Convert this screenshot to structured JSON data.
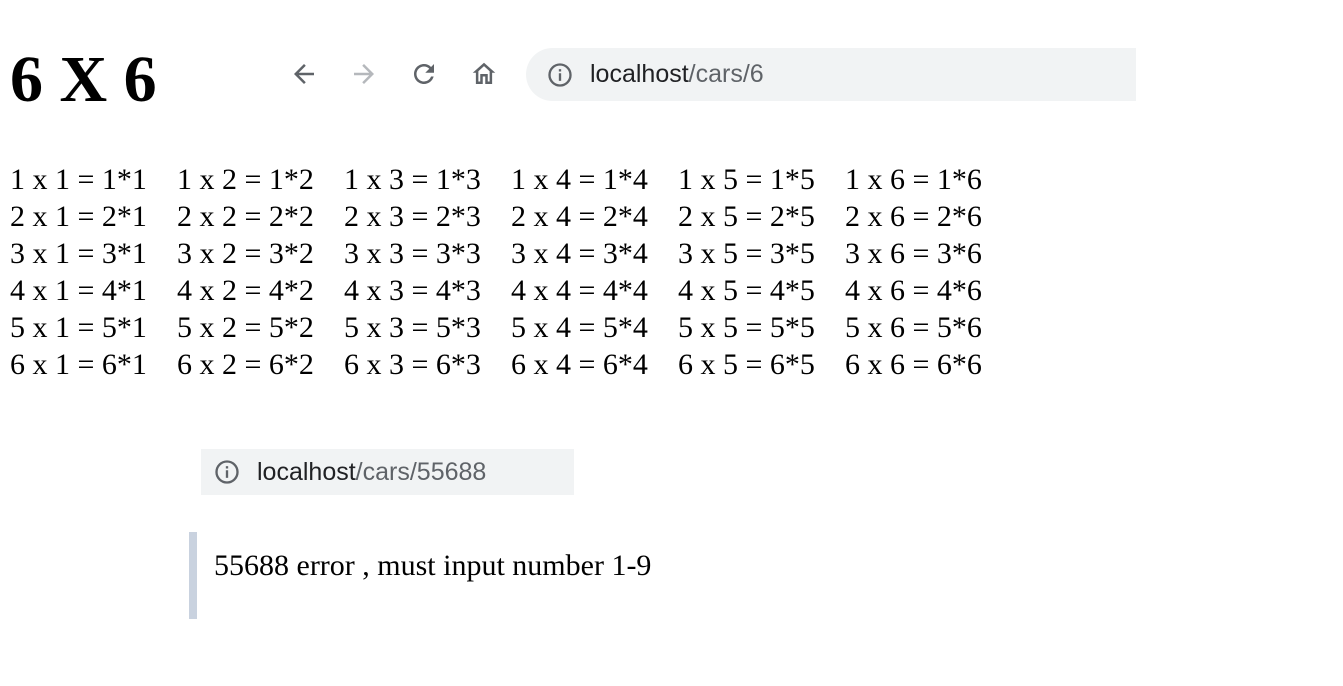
{
  "heading": "6 X 6",
  "browser_top": {
    "nav": {
      "back_icon": "arrow-left-icon",
      "forward_icon": "arrow-right-icon",
      "reload_icon": "reload-icon",
      "home_icon": "home-icon"
    },
    "address": {
      "icon": "info-icon",
      "host": "localhost",
      "path": "/cars/6"
    }
  },
  "table": {
    "rows": [
      [
        "1 x 1 = 1*1",
        "1 x 2 = 1*2",
        "1 x 3 = 1*3",
        "1 x 4 = 1*4",
        "1 x 5 = 1*5",
        "1 x 6 = 1*6"
      ],
      [
        "2 x 1 = 2*1",
        "2 x 2 = 2*2",
        "2 x 3 = 2*3",
        "2 x 4 = 2*4",
        "2 x 5 = 2*5",
        "2 x 6 = 2*6"
      ],
      [
        "3 x 1 = 3*1",
        "3 x 2 = 3*2",
        "3 x 3 = 3*3",
        "3 x 4 = 3*4",
        "3 x 5 = 3*5",
        "3 x 6 = 3*6"
      ],
      [
        "4 x 1 = 4*1",
        "4 x 2 = 4*2",
        "4 x 3 = 4*3",
        "4 x 4 = 4*4",
        "4 x 5 = 4*5",
        "4 x 6 = 4*6"
      ],
      [
        "5 x 1 = 5*1",
        "5 x 2 = 5*2",
        "5 x 3 = 5*3",
        "5 x 4 = 5*4",
        "5 x 5 = 5*5",
        "5 x 6 = 5*6"
      ],
      [
        "6 x 1 = 6*1",
        "6 x 2 = 6*2",
        "6 x 3 = 6*3",
        "6 x 4 = 6*4",
        "6 x 5 = 6*5",
        "6 x 6 = 6*6"
      ]
    ]
  },
  "browser_bottom": {
    "address": {
      "icon": "info-icon",
      "host": "localhost",
      "path": "/cars/55688"
    }
  },
  "error": {
    "message": "55688 error , must input number 1-9"
  },
  "colors": {
    "address_bg": "#f1f3f4",
    "icon_active": "#5f6368",
    "icon_disabled": "#b5b8bc",
    "quote_border": "#c9d2df"
  }
}
